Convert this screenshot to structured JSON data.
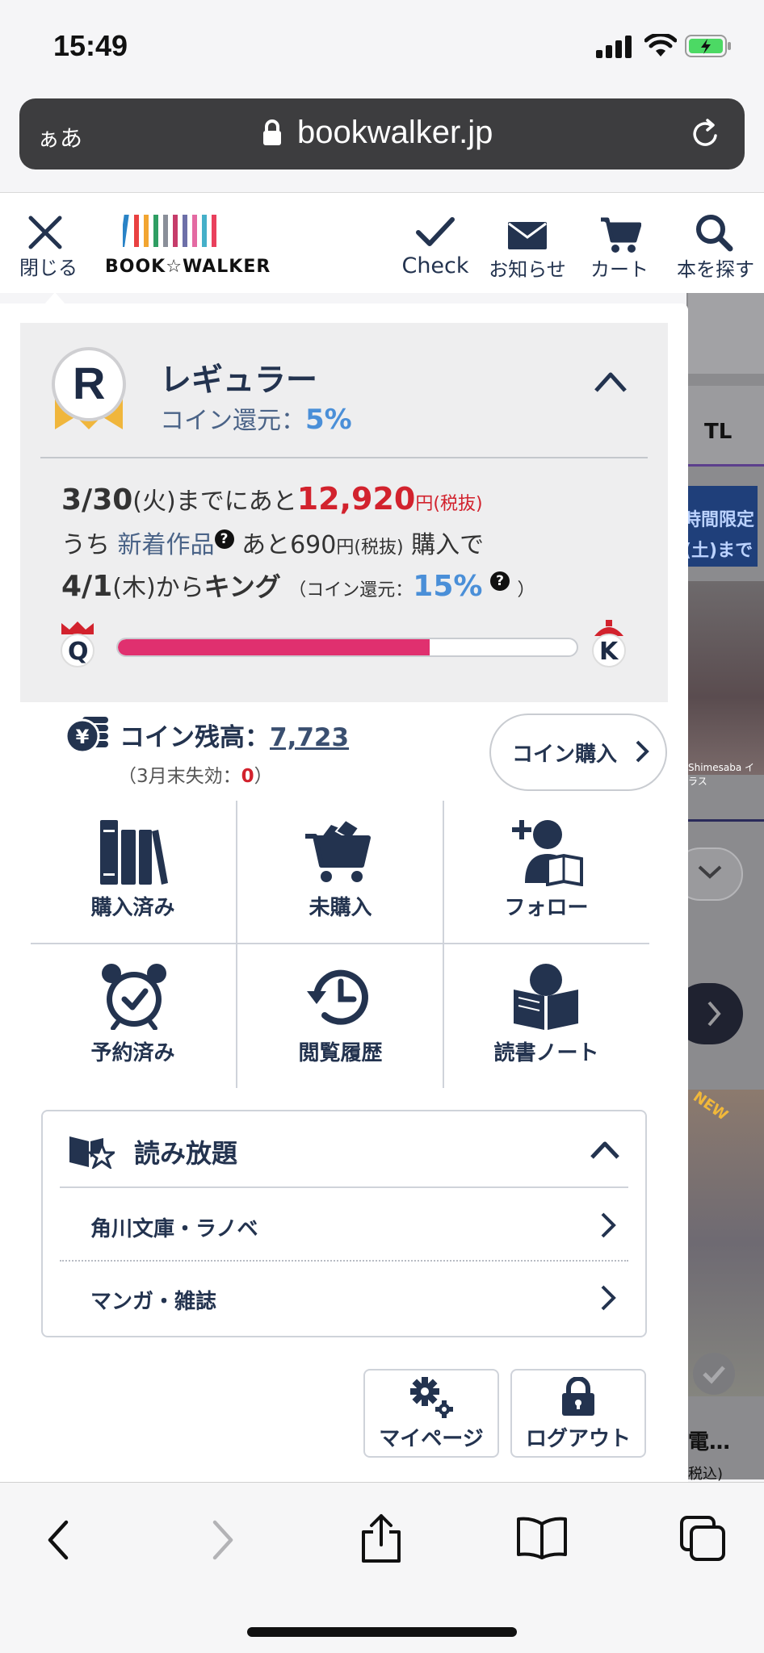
{
  "status_bar": {
    "time": "15:49"
  },
  "browser": {
    "aa_label": "ぁあ",
    "url": "bookwalker.jp"
  },
  "nav": {
    "close_label": "閉じる",
    "logo_text": "BOOK☆WALKER",
    "check_label": "Check",
    "news_label": "お知らせ",
    "cart_label": "カート",
    "search_label": "本を探す"
  },
  "rank": {
    "badge_letter": "R",
    "title": "レギュラー",
    "coin_return_label": "コイン還元：",
    "coin_return_value": "5%",
    "deadline_date": "3/30",
    "deadline_day": "(火)",
    "deadline_text": "までにあと",
    "remaining_amount": "12,920",
    "remaining_unit": "円(税抜)",
    "new_prefix": "うち",
    "new_label": "新着作品",
    "new_remaining": "あと690",
    "new_unit": "円(税抜)",
    "new_suffix": "購入で",
    "next_date": "4/1",
    "next_day": "(木)",
    "next_text": "から",
    "next_rank": "キング",
    "next_coin_label": "（コイン還元：",
    "next_coin_value": "15%",
    "next_coin_close": "）",
    "progress_start_letter": "Q",
    "progress_end_letter": "K",
    "progress": 0.68
  },
  "coin": {
    "balance_label": "コイン残高：",
    "balance_value": "7,723",
    "expire_prefix": "（3月末失効：",
    "expire_value": "0",
    "expire_suffix": "）",
    "buy_label": "コイン購入"
  },
  "menu": {
    "purchased": "購入済み",
    "unpurchased": "未購入",
    "follow": "フォロー",
    "reserved": "予約済み",
    "history": "閲覧履歴",
    "reading_note": "読書ノート"
  },
  "yomihodai": {
    "title": "読み放題",
    "items": [
      "角川文庫・ラノベ",
      "マンガ・雑誌"
    ]
  },
  "footer": {
    "mypage": "マイページ",
    "logout": "ログアウト"
  },
  "background": {
    "tab_tl": "TL",
    "banner_line1": "時間限定",
    "banner_line2": "(土)まで",
    "credit": "Shimesaba イラス",
    "new_badge": "NEW",
    "title_trunc": "電…",
    "price_trunc": "税込)"
  },
  "colors": {
    "navy": "#23334f",
    "accent_blue": "#4a8fd8",
    "red": "#d2222d",
    "progress": "#e0306f"
  }
}
